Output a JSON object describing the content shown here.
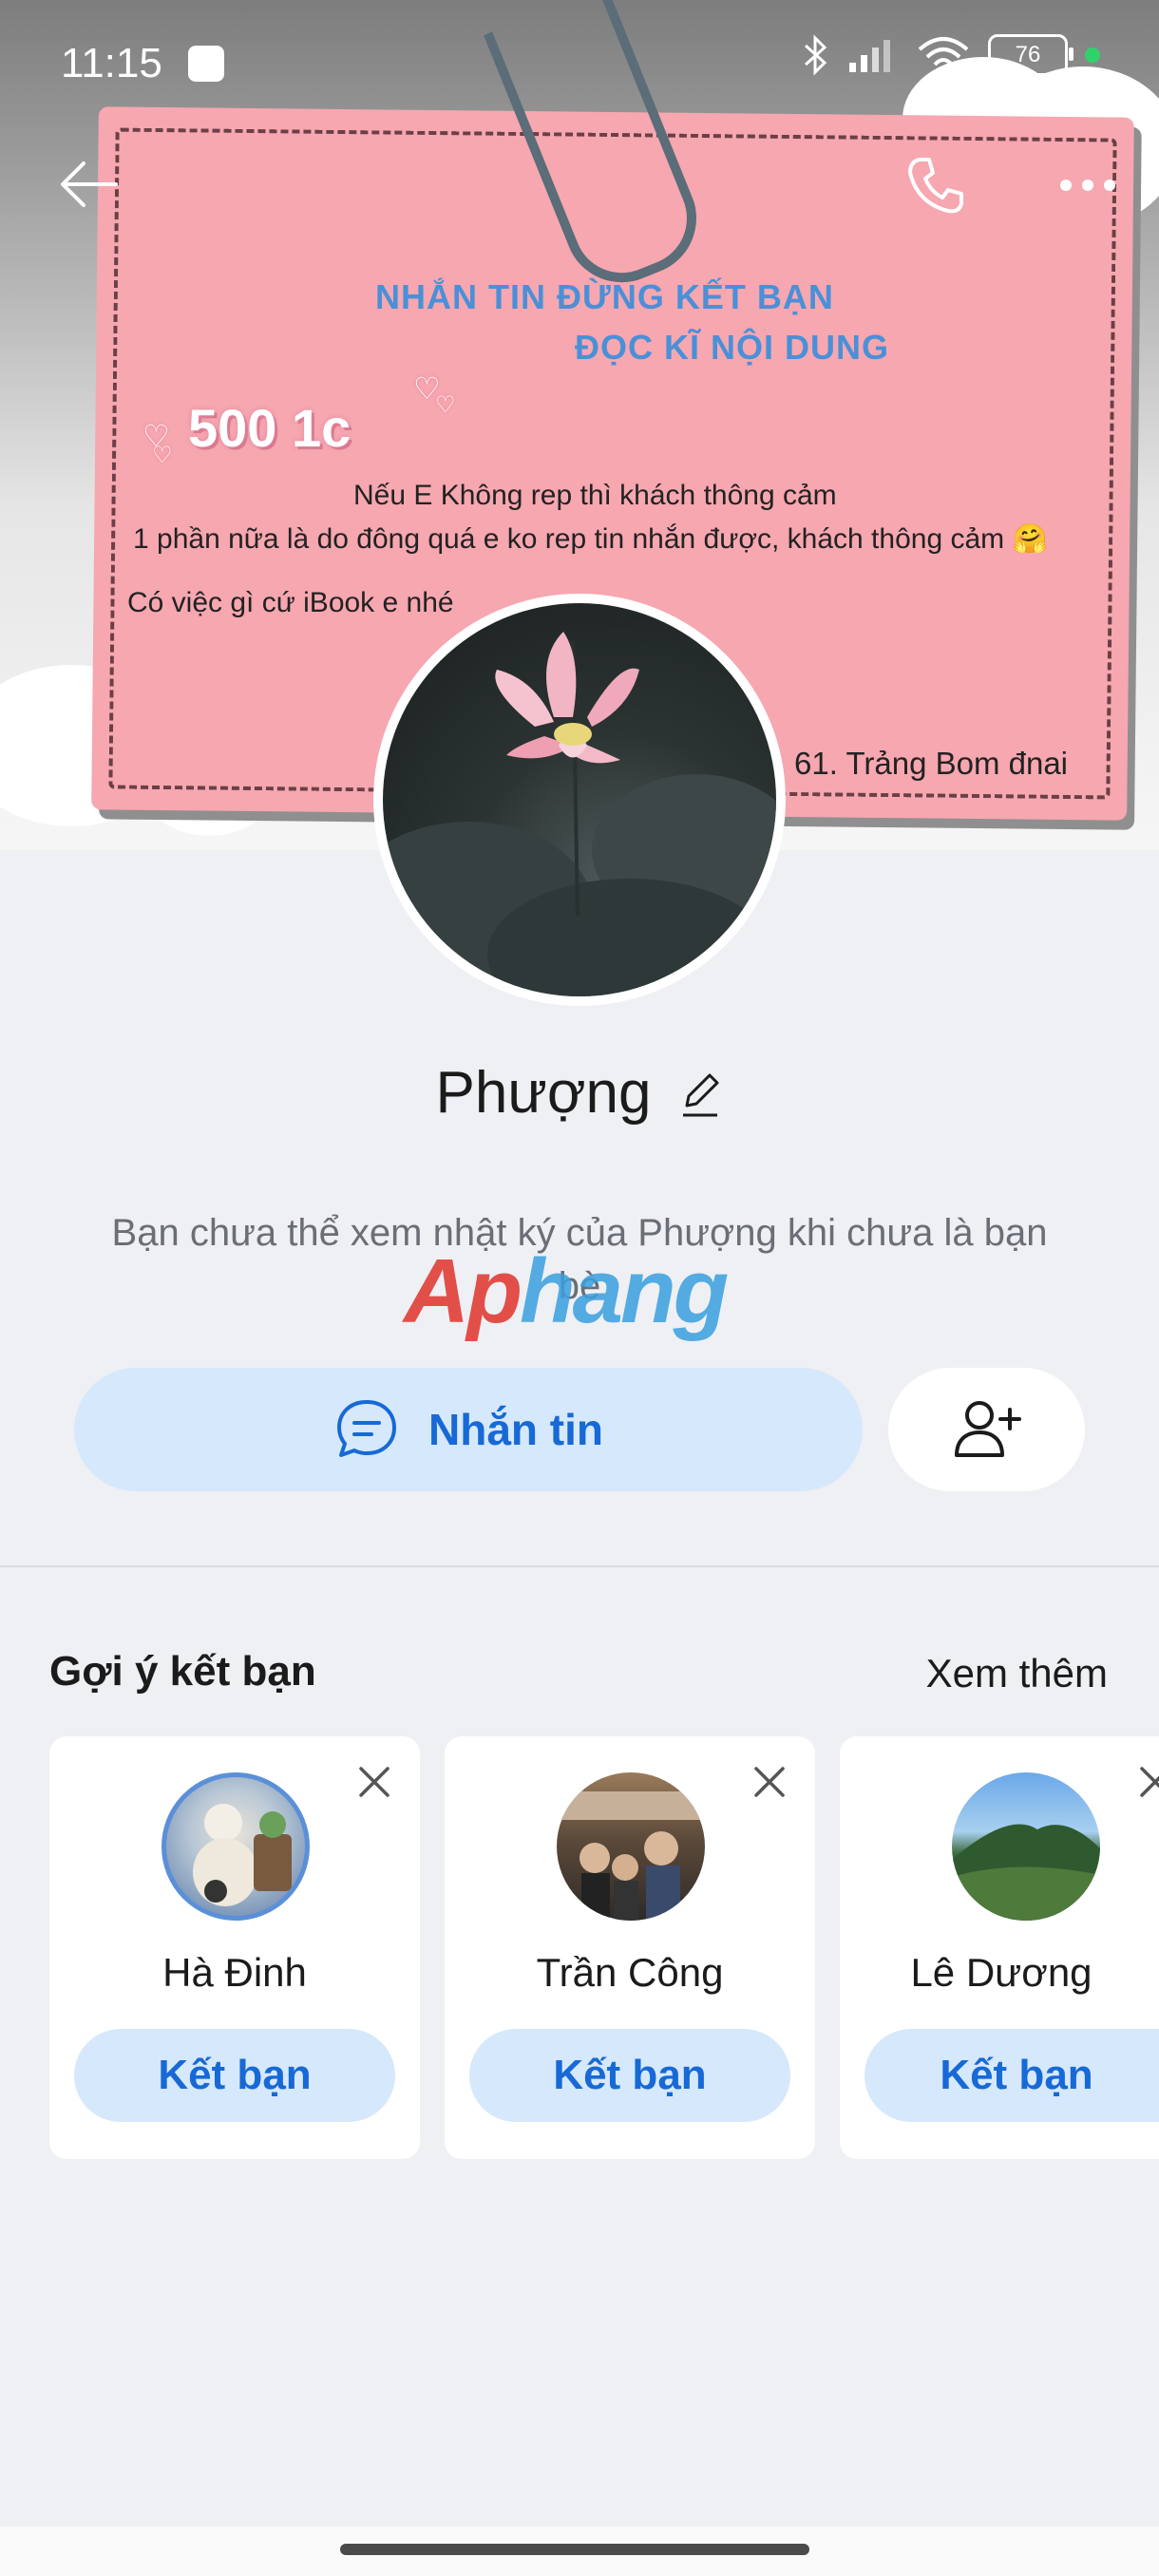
{
  "status_bar": {
    "time": "11:15",
    "battery": "76",
    "icons": [
      "bluetooth-icon",
      "signal-icon",
      "wifi-icon",
      "battery-icon"
    ]
  },
  "cover": {
    "note_title_1": "NHẮN TIN ĐỪNG KẾT BẠN",
    "note_title_2": "ĐỌC KĨ NỘI DUNG",
    "note_price": "500 1c",
    "note_line_1": "Nếu E Không rep thì khách thông cảm",
    "note_line_2": "1 phần nữa là do đông quá e ko rep tin nhắn được, khách thông cảm 🤗",
    "note_line_3": "Có việc gì cứ iBook e nhé",
    "note_address": "61. Trảng Bom đnai"
  },
  "profile": {
    "name": "Phượng",
    "diary_notice": "Bạn chưa thể xem nhật ký của Phượng khi chưa là bạn bè",
    "watermark": "Aphang"
  },
  "actions": {
    "message_label": "Nhắn tin"
  },
  "suggestions": {
    "title": "Gợi ý kết bạn",
    "see_more": "Xem thêm",
    "items": [
      {
        "name": "Hà Đinh",
        "button": "Kết bạn"
      },
      {
        "name": "Trần Công",
        "button": "Kết bạn"
      },
      {
        "name": "Lê Dương",
        "button": "Kết bạn"
      }
    ]
  },
  "colors": {
    "accent": "#1769d6",
    "button_bg": "#d6e8fb",
    "page_bg": "#eef0f4",
    "note_pink": "#f6a7b0"
  }
}
